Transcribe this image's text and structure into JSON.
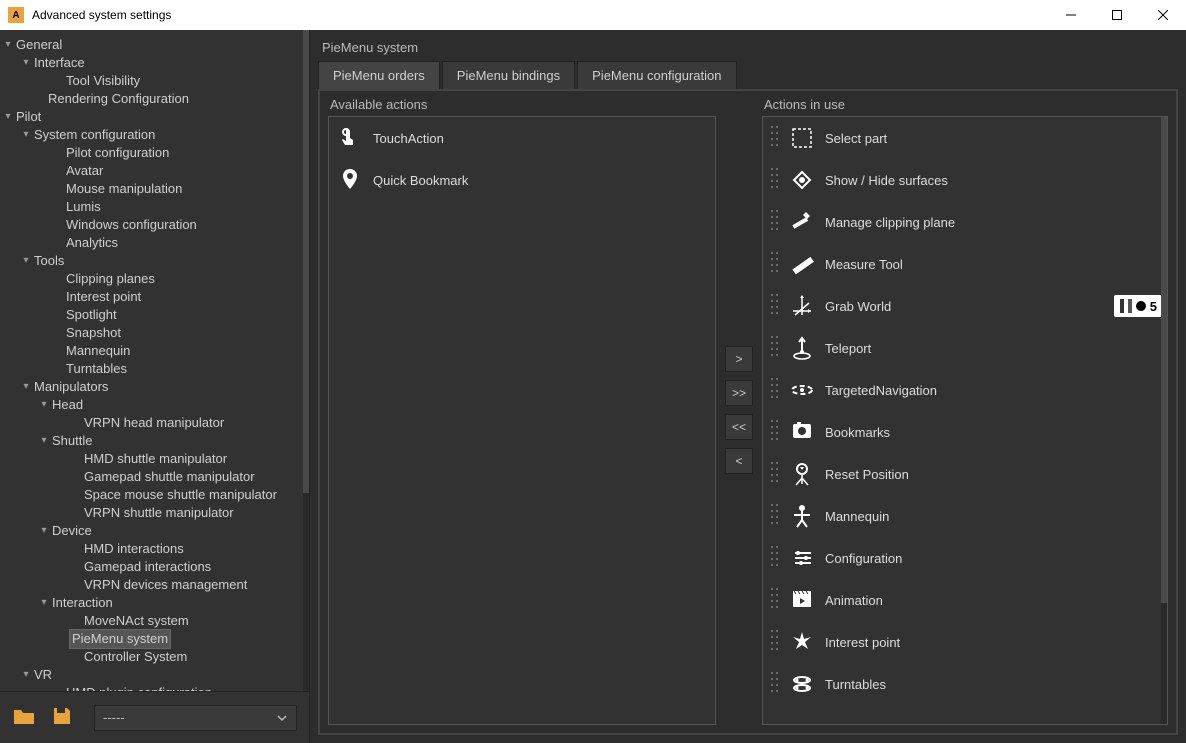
{
  "window": {
    "title": "Advanced system settings"
  },
  "tree": [
    {
      "level": 0,
      "label": "General",
      "expander": "▾"
    },
    {
      "level": 1,
      "label": "Interface",
      "expander": "▾"
    },
    {
      "level": 2,
      "label": "Tool Visibility",
      "indent": true
    },
    {
      "level": 1,
      "label": "Rendering Configuration",
      "indent": true
    },
    {
      "level": 0,
      "label": "Pilot",
      "expander": "▾"
    },
    {
      "level": 1,
      "label": "System configuration",
      "expander": "▾"
    },
    {
      "level": 2,
      "label": "Pilot configuration",
      "indent": true
    },
    {
      "level": 2,
      "label": "Avatar",
      "indent": true
    },
    {
      "level": 2,
      "label": "Mouse manipulation",
      "indent": true
    },
    {
      "level": 2,
      "label": "Lumis",
      "indent": true
    },
    {
      "level": 2,
      "label": "Windows configuration",
      "indent": true
    },
    {
      "level": 2,
      "label": "Analytics",
      "indent": true
    },
    {
      "level": 1,
      "label": "Tools",
      "expander": "▾"
    },
    {
      "level": 2,
      "label": "Clipping planes",
      "indent": true
    },
    {
      "level": 2,
      "label": "Interest point",
      "indent": true
    },
    {
      "level": 2,
      "label": "Spotlight",
      "indent": true
    },
    {
      "level": 2,
      "label": "Snapshot",
      "indent": true
    },
    {
      "level": 2,
      "label": "Mannequin",
      "indent": true
    },
    {
      "level": 2,
      "label": "Turntables",
      "indent": true
    },
    {
      "level": 1,
      "label": "Manipulators",
      "expander": "▾"
    },
    {
      "level": 2,
      "label": "Head",
      "expander": "▾"
    },
    {
      "level": 3,
      "label": "VRPN head manipulator",
      "indent": true
    },
    {
      "level": 2,
      "label": "Shuttle",
      "expander": "▾"
    },
    {
      "level": 3,
      "label": "HMD shuttle manipulator",
      "indent": true
    },
    {
      "level": 3,
      "label": "Gamepad shuttle manipulator",
      "indent": true
    },
    {
      "level": 3,
      "label": "Space mouse shuttle manipulator",
      "indent": true
    },
    {
      "level": 3,
      "label": "VRPN shuttle manipulator",
      "indent": true
    },
    {
      "level": 2,
      "label": "Device",
      "expander": "▾"
    },
    {
      "level": 3,
      "label": "HMD interactions",
      "indent": true
    },
    {
      "level": 3,
      "label": "Gamepad interactions",
      "indent": true
    },
    {
      "level": 3,
      "label": "VRPN devices management",
      "indent": true
    },
    {
      "level": 2,
      "label": "Interaction",
      "expander": "▾"
    },
    {
      "level": 3,
      "label": "MoveNAct system",
      "indent": true
    },
    {
      "level": 3,
      "label": "PieMenu system",
      "selected": true,
      "indent": true
    },
    {
      "level": 3,
      "label": "Controller System",
      "indent": true
    },
    {
      "level": 1,
      "label": "VR",
      "expander": "▾"
    },
    {
      "level": 2,
      "label": "HMD plugin configuration",
      "indent": true
    }
  ],
  "footer": {
    "combo_value": "-----"
  },
  "panel": {
    "title": "PieMenu system",
    "tabs": [
      "PieMenu orders",
      "PieMenu bindings",
      "PieMenu configuration"
    ],
    "active_tab": 0,
    "available_title": "Available actions",
    "inuse_title": "Actions in use",
    "available": [
      {
        "icon": "touch",
        "label": "TouchAction"
      },
      {
        "icon": "pin",
        "label": "Quick Bookmark"
      }
    ],
    "inuse": [
      {
        "icon": "select",
        "label": "Select part"
      },
      {
        "icon": "showhide",
        "label": "Show / Hide surfaces"
      },
      {
        "icon": "clip",
        "label": "Manage clipping plane"
      },
      {
        "icon": "measure",
        "label": "Measure Tool"
      },
      {
        "icon": "grab",
        "label": "Grab World",
        "badge": "5"
      },
      {
        "icon": "teleport",
        "label": "Teleport"
      },
      {
        "icon": "target",
        "label": "TargetedNavigation"
      },
      {
        "icon": "bookmark",
        "label": "Bookmarks"
      },
      {
        "icon": "reset",
        "label": "Reset Position"
      },
      {
        "icon": "mannequin",
        "label": "Mannequin"
      },
      {
        "icon": "config",
        "label": "Configuration"
      },
      {
        "icon": "anim",
        "label": "Animation"
      },
      {
        "icon": "interest",
        "label": "Interest point"
      },
      {
        "icon": "turntable",
        "label": "Turntables"
      }
    ],
    "move_buttons": [
      ">",
      ">>",
      "<<",
      "<"
    ]
  }
}
